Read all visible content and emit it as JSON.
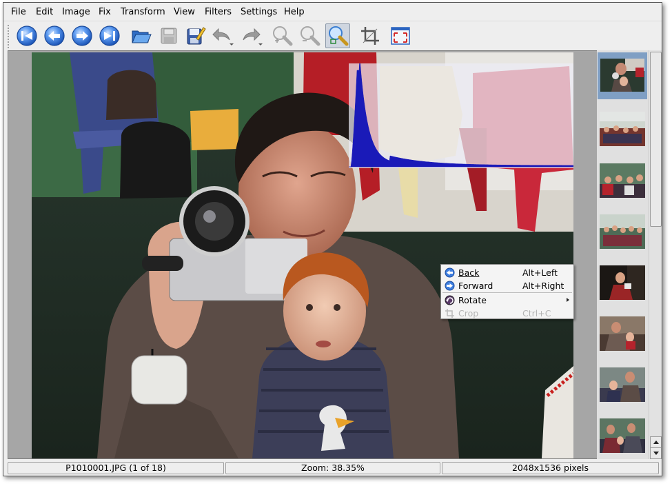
{
  "menu": {
    "items": [
      {
        "label": "File",
        "mnemonic": "F"
      },
      {
        "label": "Edit",
        "mnemonic": "E"
      },
      {
        "label": "Image",
        "mnemonic": "I"
      },
      {
        "label": "Fix",
        "mnemonic": "x"
      },
      {
        "label": "Transform",
        "mnemonic": "T"
      },
      {
        "label": "View",
        "mnemonic": "V"
      },
      {
        "label": "Filters",
        "mnemonic": "l"
      },
      {
        "label": "Settings",
        "mnemonic": "S"
      },
      {
        "label": "Help",
        "mnemonic": "H"
      }
    ]
  },
  "toolbar": {
    "buttons": [
      {
        "icon": "first-image-icon",
        "state": "enabled"
      },
      {
        "icon": "back-icon",
        "state": "enabled"
      },
      {
        "icon": "forward-icon",
        "state": "enabled"
      },
      {
        "icon": "last-image-icon",
        "state": "enabled"
      },
      {
        "icon": "open-folder-icon",
        "state": "enabled"
      },
      {
        "icon": "save-icon",
        "state": "disabled"
      },
      {
        "icon": "edit-properties-icon",
        "state": "enabled"
      },
      {
        "icon": "undo-icon",
        "state": "disabled"
      },
      {
        "icon": "redo-icon",
        "state": "disabled"
      },
      {
        "icon": "zoom-in-icon",
        "state": "disabled"
      },
      {
        "icon": "zoom-out-icon",
        "state": "disabled"
      },
      {
        "icon": "zoom-fit-icon",
        "state": "active"
      },
      {
        "icon": "crop-icon",
        "state": "enabled"
      },
      {
        "icon": "fullscreen-icon",
        "state": "enabled"
      }
    ],
    "accent": "#2f6fd0"
  },
  "viewer": {
    "image": "family-photo",
    "histogram_color": "#1a1ab8"
  },
  "context_menu": {
    "items": [
      {
        "label": "Back",
        "mnemonic": "B",
        "shortcut": "Alt+Left",
        "icon": "back-icon",
        "enabled": true
      },
      {
        "label": "Forward",
        "mnemonic": "F",
        "shortcut": "Alt+Right",
        "icon": "forward-icon",
        "enabled": true
      },
      {
        "label": "Rotate",
        "mnemonic": "R",
        "shortcut": "",
        "icon": "rotate-icon",
        "enabled": true,
        "submenu": true
      },
      {
        "label": "Crop",
        "mnemonic": "",
        "shortcut": "Ctrl+C",
        "icon": "crop-icon",
        "enabled": false
      }
    ]
  },
  "thumbnails": {
    "count_visible": 8,
    "selected_index": 0
  },
  "status": {
    "file": "P1010001.JPG (1 of 18)",
    "zoom": "Zoom: 38.35%",
    "size": "2048x1536 pixels"
  }
}
